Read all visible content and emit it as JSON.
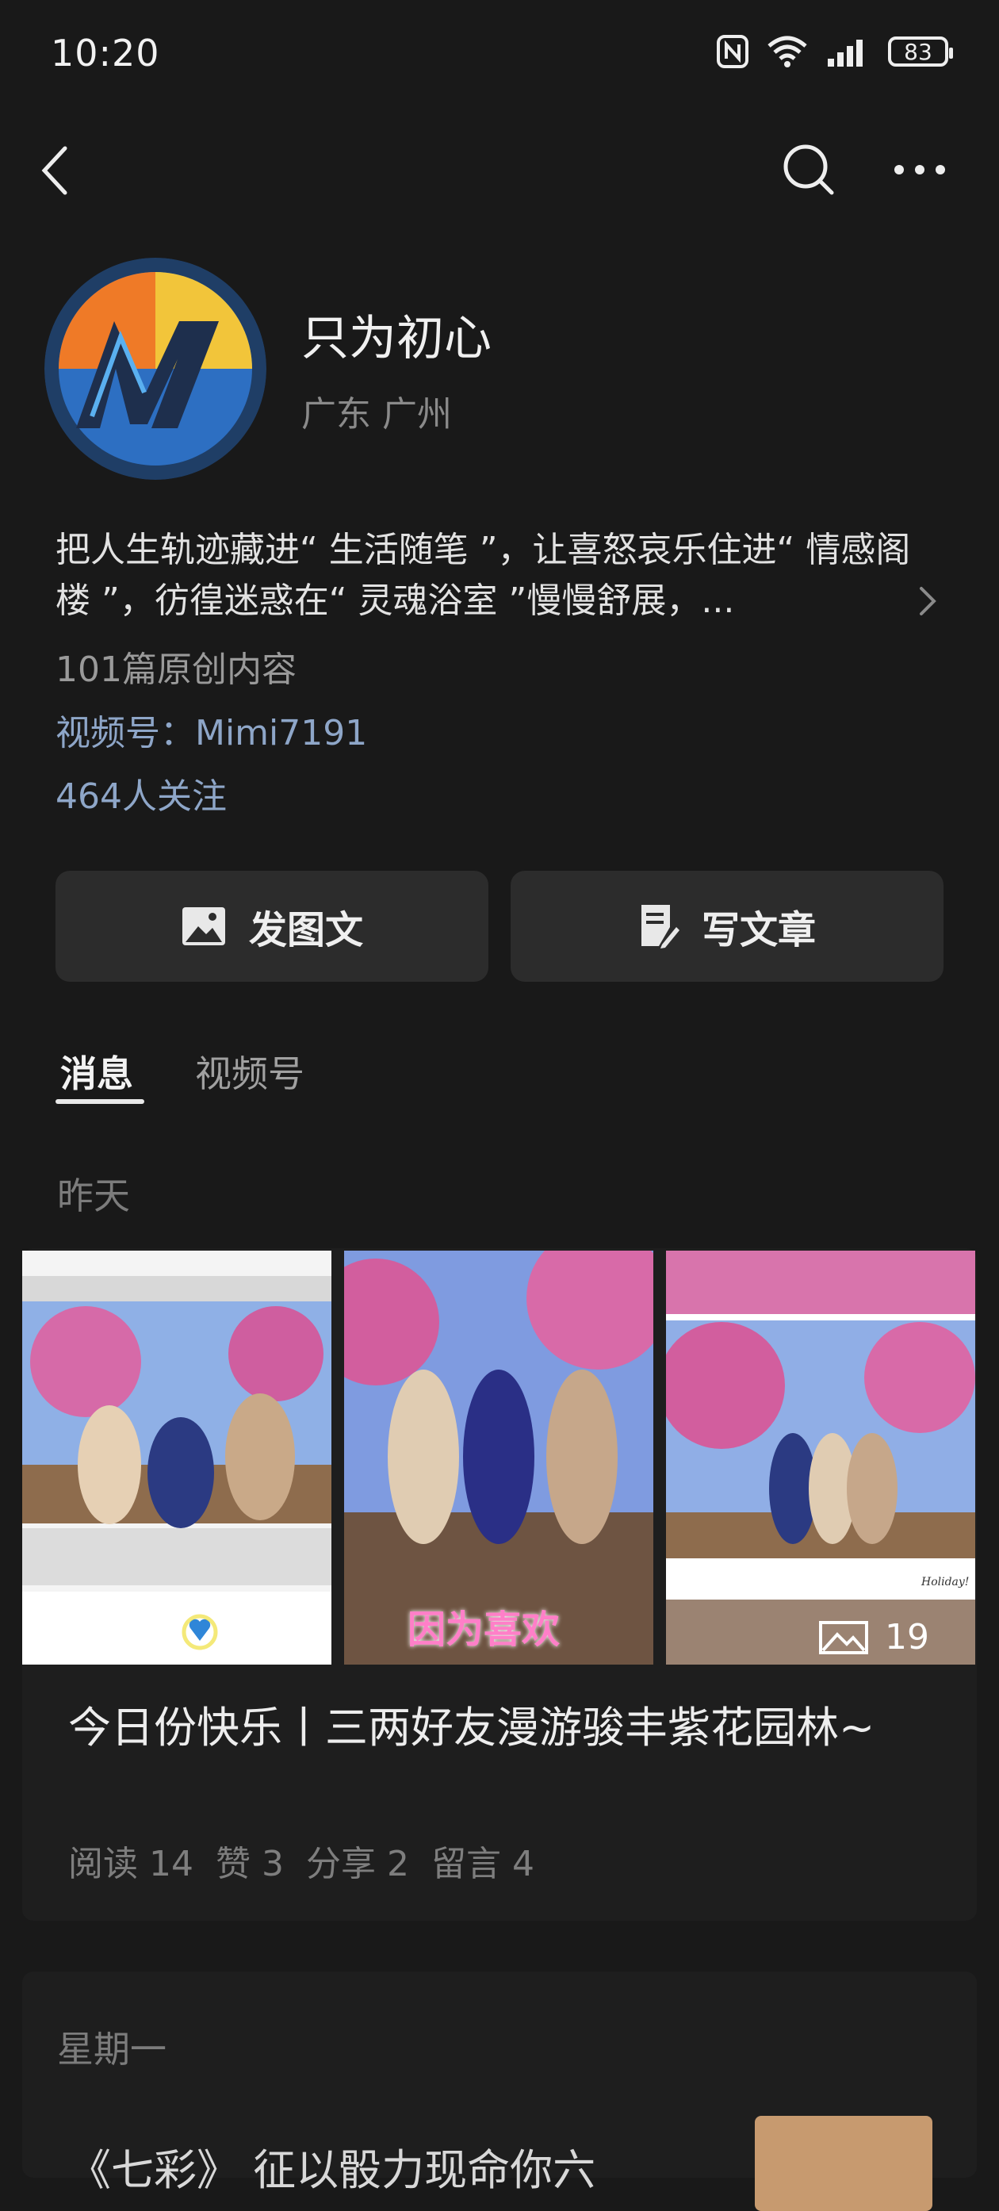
{
  "status": {
    "time": "10:20",
    "battery": "83"
  },
  "nav": {
    "back_icon": "chevron-left-icon",
    "search_icon": "search-icon",
    "more_icon": "more-icon"
  },
  "profile": {
    "name": "只为初心",
    "location": "广东 广州",
    "bio": "把人生轨迹藏进“ 生活随笔 ”，让喜怒哀乐住进“ 情感阁楼 ”，彷徨迷惑在“ 灵魂浴室 ”慢慢舒展，...",
    "original_count": "101篇原创内容",
    "video_account": "视频号：Mimi7191",
    "followers": "464人关注"
  },
  "actions": {
    "post_image_text": "发图文",
    "write_article": "写文章"
  },
  "tabs": [
    {
      "label": "消息",
      "active": true
    },
    {
      "label": "视频号",
      "active": false
    }
  ],
  "feed": {
    "date": "昨天",
    "article": {
      "title": "今日份快乐丨三两好友漫游骏丰紫花园林~",
      "image_overlay_text": "因为喜欢",
      "photo_caption": "Holiday!",
      "image_count": "19",
      "stats": {
        "read": "阅读 14",
        "like": "赞 3",
        "share": "分享 2",
        "comment": "留言 4"
      }
    },
    "date2": "星期一",
    "title2_partial": "《七彩》 征以骰力现命你六"
  },
  "colors": {
    "background": "#191919",
    "card": "#1e1e1e",
    "button": "#2c2c2c",
    "link": "#8ea6c8"
  }
}
